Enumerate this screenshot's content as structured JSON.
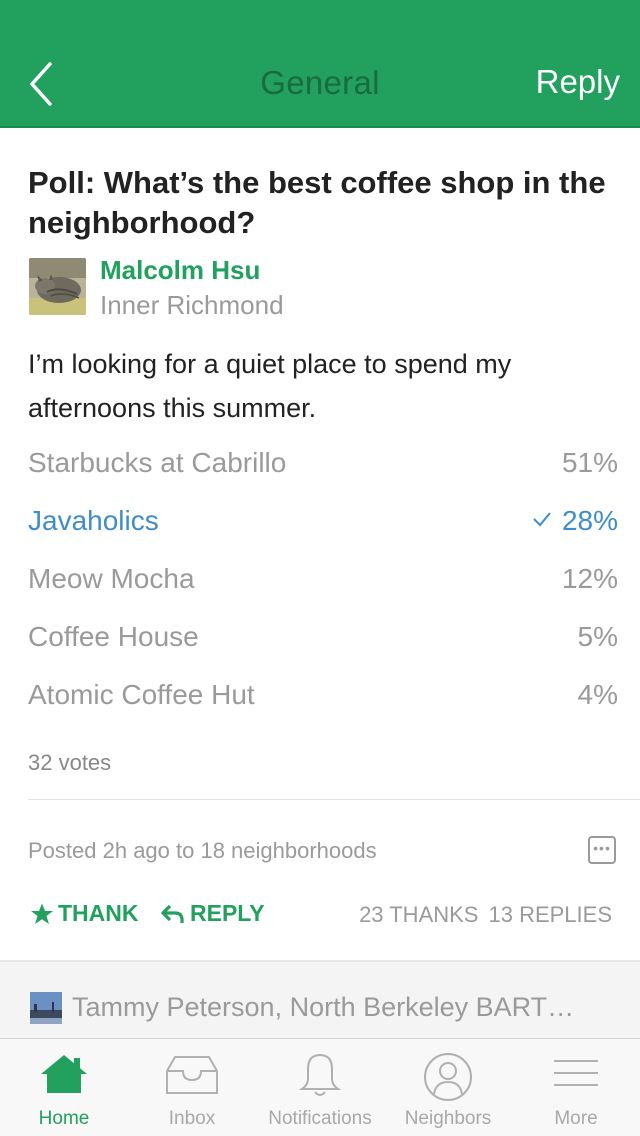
{
  "nav": {
    "title": "General",
    "reply_label": "Reply"
  },
  "post": {
    "title": "Poll: What’s the best coffee shop in the neighborhood?",
    "author": {
      "name": "Malcolm Hsu",
      "neighborhood": "Inner Richmond"
    },
    "body": "I’m looking for a quiet place to spend my afternoons this summer."
  },
  "poll": {
    "options": [
      {
        "label": "Starbucks at Cabrillo",
        "percent": "51%",
        "selected": false
      },
      {
        "label": "Javaholics",
        "percent": "28%",
        "selected": true
      },
      {
        "label": "Meow Mocha",
        "percent": "12%",
        "selected": false
      },
      {
        "label": "Coffee House",
        "percent": "5%",
        "selected": false
      },
      {
        "label": "Atomic Coffee Hut",
        "percent": "4%",
        "selected": false
      }
    ],
    "votes": "32 votes"
  },
  "meta": {
    "posted": "Posted 2h ago to 18 neighborhoods"
  },
  "actions": {
    "thank_label": "THANK",
    "reply_label": "REPLY",
    "thanks_count": "23 THANKS",
    "replies_count": "13 REPLIES"
  },
  "next_post": {
    "text": "Tammy Peterson, North Berkeley BART…"
  },
  "tabs": [
    {
      "label": "Home",
      "icon": "home-icon",
      "active": true
    },
    {
      "label": "Inbox",
      "icon": "inbox-icon",
      "active": false
    },
    {
      "label": "Notifications",
      "icon": "bell-icon",
      "active": false
    },
    {
      "label": "Neighbors",
      "icon": "neighbors-icon",
      "active": false
    },
    {
      "label": "More",
      "icon": "menu-icon",
      "active": false
    }
  ],
  "colors": {
    "brand_green": "#22a05d",
    "selected_blue": "#3e8dcb",
    "muted_gray": "#9a9a9a"
  }
}
